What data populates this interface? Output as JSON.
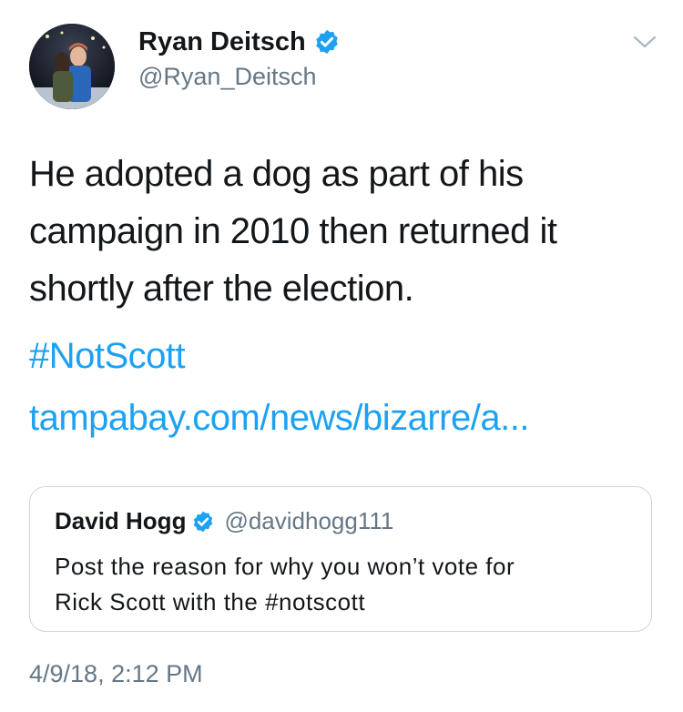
{
  "author": {
    "name": "Ryan Deitsch",
    "handle": "@Ryan_Deitsch",
    "verified": true,
    "avatar_icon": "profile-photo"
  },
  "menu": {
    "icon": "chevron-down-icon"
  },
  "tweet": {
    "text_lines": [
      "He adopted a dog as part of his",
      "campaign in 2010 then returned it",
      "shortly after the election."
    ],
    "hashtag": "#NotScott",
    "link": "tampabay.com/news/bizarre/a..."
  },
  "quoted_tweet": {
    "name": "David Hogg",
    "handle": "@davidhogg111",
    "verified": true,
    "text_lines": [
      "Post the reason for why you won’t vote for",
      "Rick Scott with the #notscott"
    ]
  },
  "timestamp": "4/9/18, 2:12 PM",
  "colors": {
    "accent": "#1da1f2",
    "muted": "#657786",
    "text": "#14171a",
    "border": "#ccd6dd"
  }
}
